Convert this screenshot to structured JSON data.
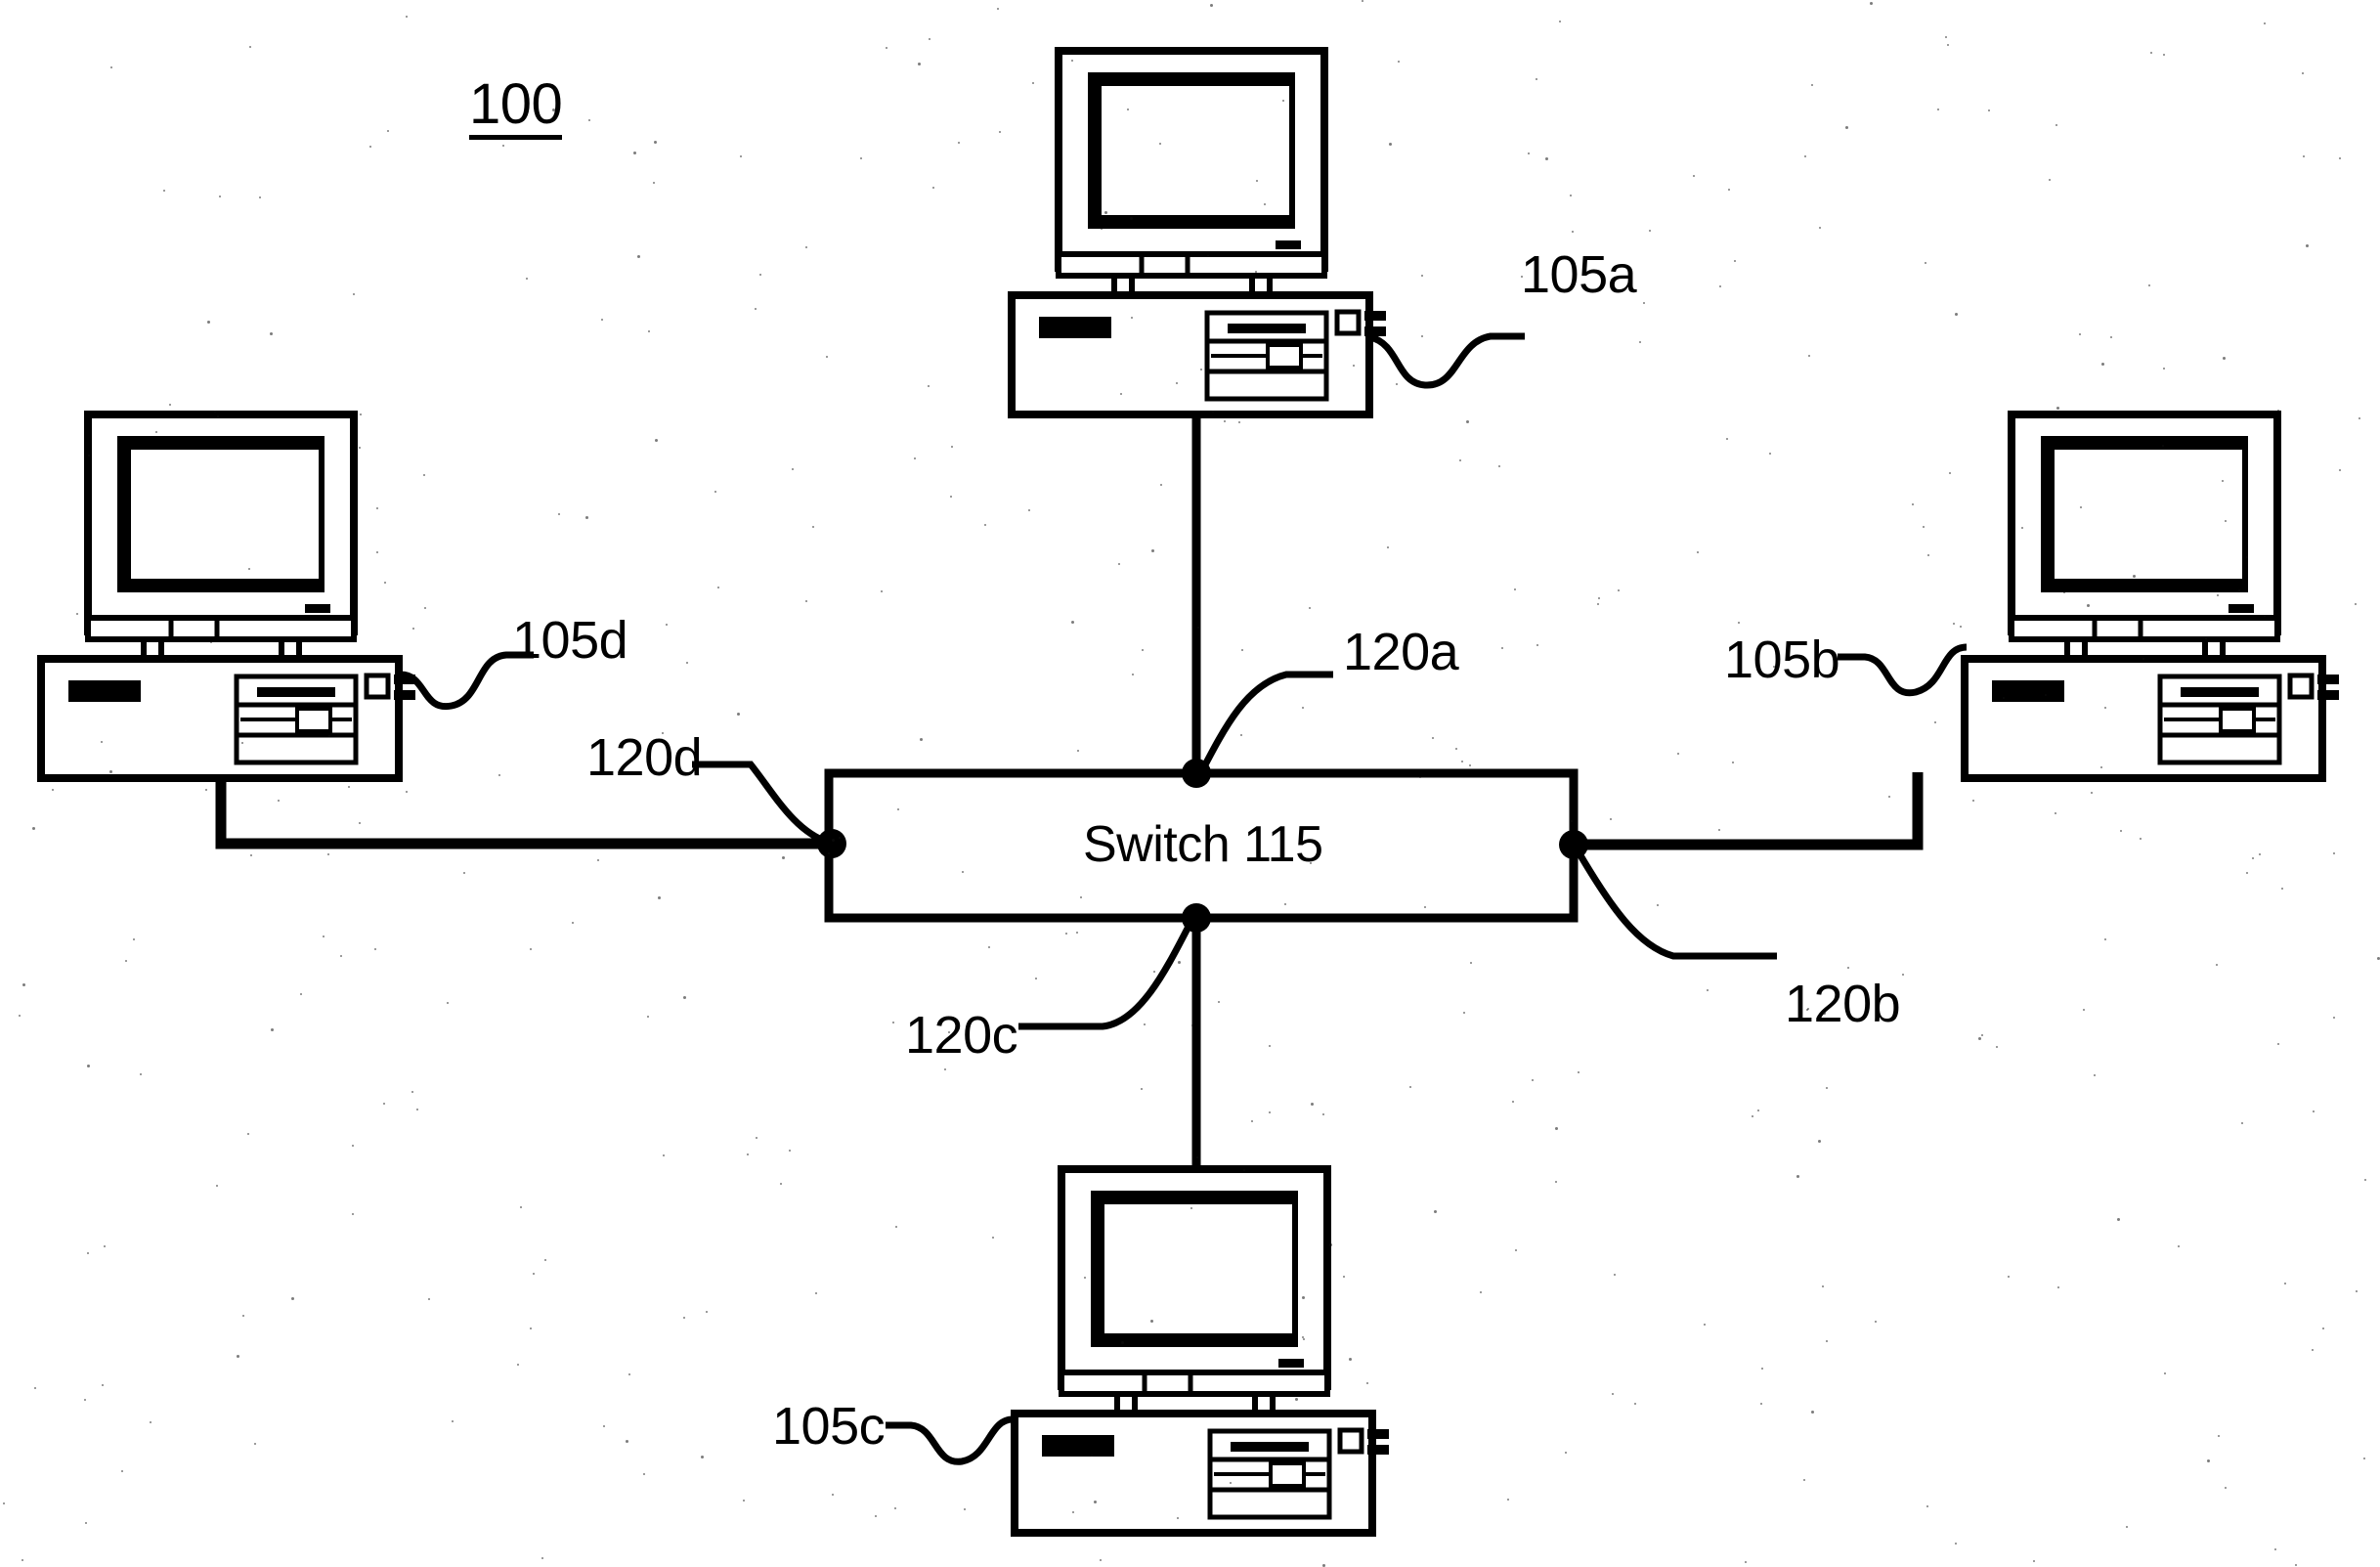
{
  "figure": {
    "number": "100",
    "type": "network-diagram",
    "background_color": "#ffffff",
    "line_color": "#000000"
  },
  "switch": {
    "label": "Switch 115",
    "ref": "115"
  },
  "nodes": [
    {
      "id": "105a",
      "label": "105a",
      "kind": "desktop-computer",
      "position": "top"
    },
    {
      "id": "105b",
      "label": "105b",
      "kind": "desktop-computer",
      "position": "right"
    },
    {
      "id": "105c",
      "label": "105c",
      "kind": "desktop-computer",
      "position": "bottom"
    },
    {
      "id": "105d",
      "label": "105d",
      "kind": "desktop-computer",
      "position": "left"
    }
  ],
  "links": [
    {
      "id": "120a",
      "label": "120a",
      "from": "105a",
      "to": "switch",
      "port": "top"
    },
    {
      "id": "120b",
      "label": "120b",
      "from": "105b",
      "to": "switch",
      "port": "right"
    },
    {
      "id": "120c",
      "label": "120c",
      "from": "105c",
      "to": "switch",
      "port": "bottom"
    },
    {
      "id": "120d",
      "label": "120d",
      "from": "105d",
      "to": "switch",
      "port": "left"
    }
  ]
}
